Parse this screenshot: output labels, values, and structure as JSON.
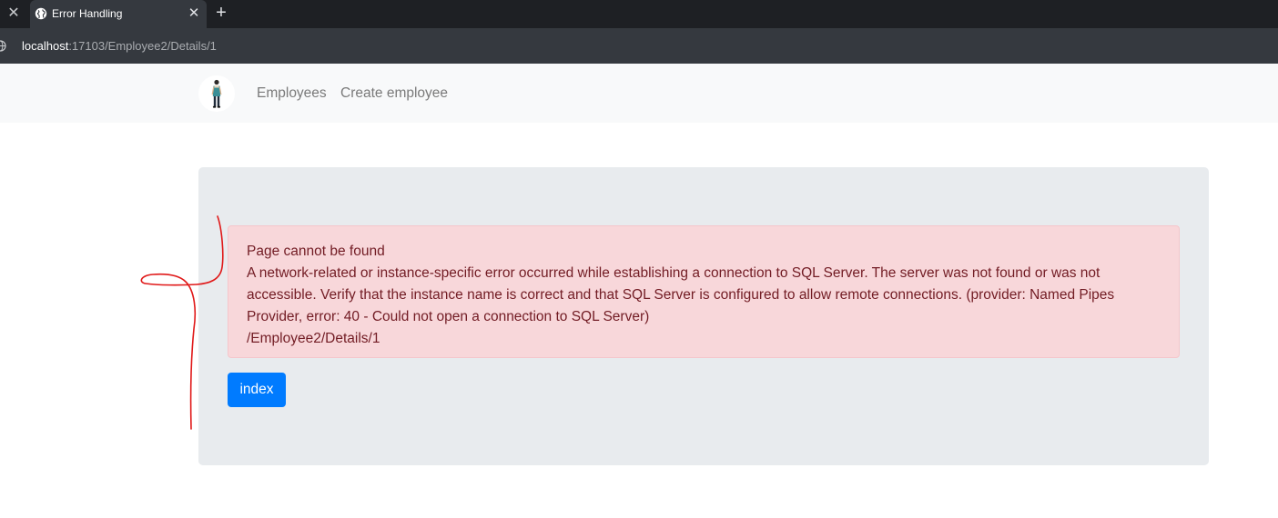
{
  "browser": {
    "tab": {
      "title": "Error Handling"
    },
    "address_bar": {
      "host": "localhost",
      "rest": ":17103/Employee2/Details/1"
    },
    "icons": {
      "prev_tab_close": "close-icon",
      "tab_favicon": "globe-icon",
      "tab_close": "close-icon",
      "new_tab": "plus-icon",
      "site_info": "globe-icon"
    }
  },
  "navbar": {
    "logo": "person-logo",
    "links": [
      "Employees",
      "Create employee"
    ]
  },
  "error": {
    "title": "Page cannot be found",
    "message": "A network-related or instance-specific error occurred while establishing a connection to SQL Server. The server was not found or was not accessible. Verify that the instance name is correct and that SQL Server is configured to allow remote connections. (provider: Named Pipes Provider, error: 40 - Could not open a connection to SQL Server)",
    "path": "/Employee2/Details/1"
  },
  "actions": {
    "index_label": "index"
  },
  "colors": {
    "alert_bg": "#f8d7da",
    "alert_text": "#721c24",
    "primary": "#007bff",
    "annotation": "#e01919",
    "jumbotron_bg": "#e8ebee"
  }
}
